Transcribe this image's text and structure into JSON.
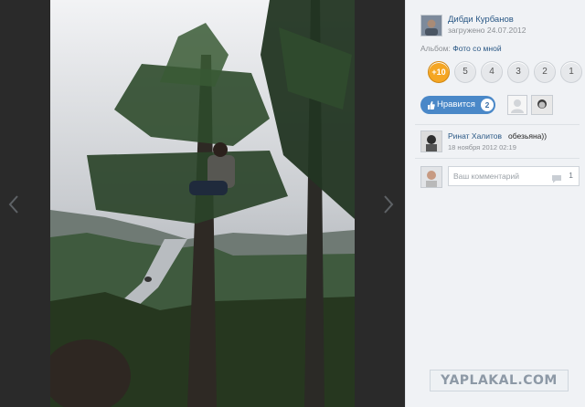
{
  "author": {
    "name": "Дибди Курбанов",
    "uploaded": "загружено 24.07.2012"
  },
  "album": {
    "label": "Альбом:",
    "name": "Фото со мной"
  },
  "rating": {
    "options": [
      "+10",
      "5",
      "4",
      "3",
      "2",
      "1"
    ],
    "selected": "+10"
  },
  "like": {
    "label": "Нравится",
    "count": "2"
  },
  "comment": {
    "author": "Ринат Халитов",
    "text": "обезьяна))",
    "date": "18 ноября 2012 02:19"
  },
  "new_comment": {
    "placeholder": "Ваш комментарий",
    "count": "1"
  },
  "watermark": "YAPLAKAL.COM",
  "icons": [
    "chevron-left-icon",
    "chevron-right-icon",
    "thumbs-up-icon",
    "speech-bubble-icon"
  ]
}
